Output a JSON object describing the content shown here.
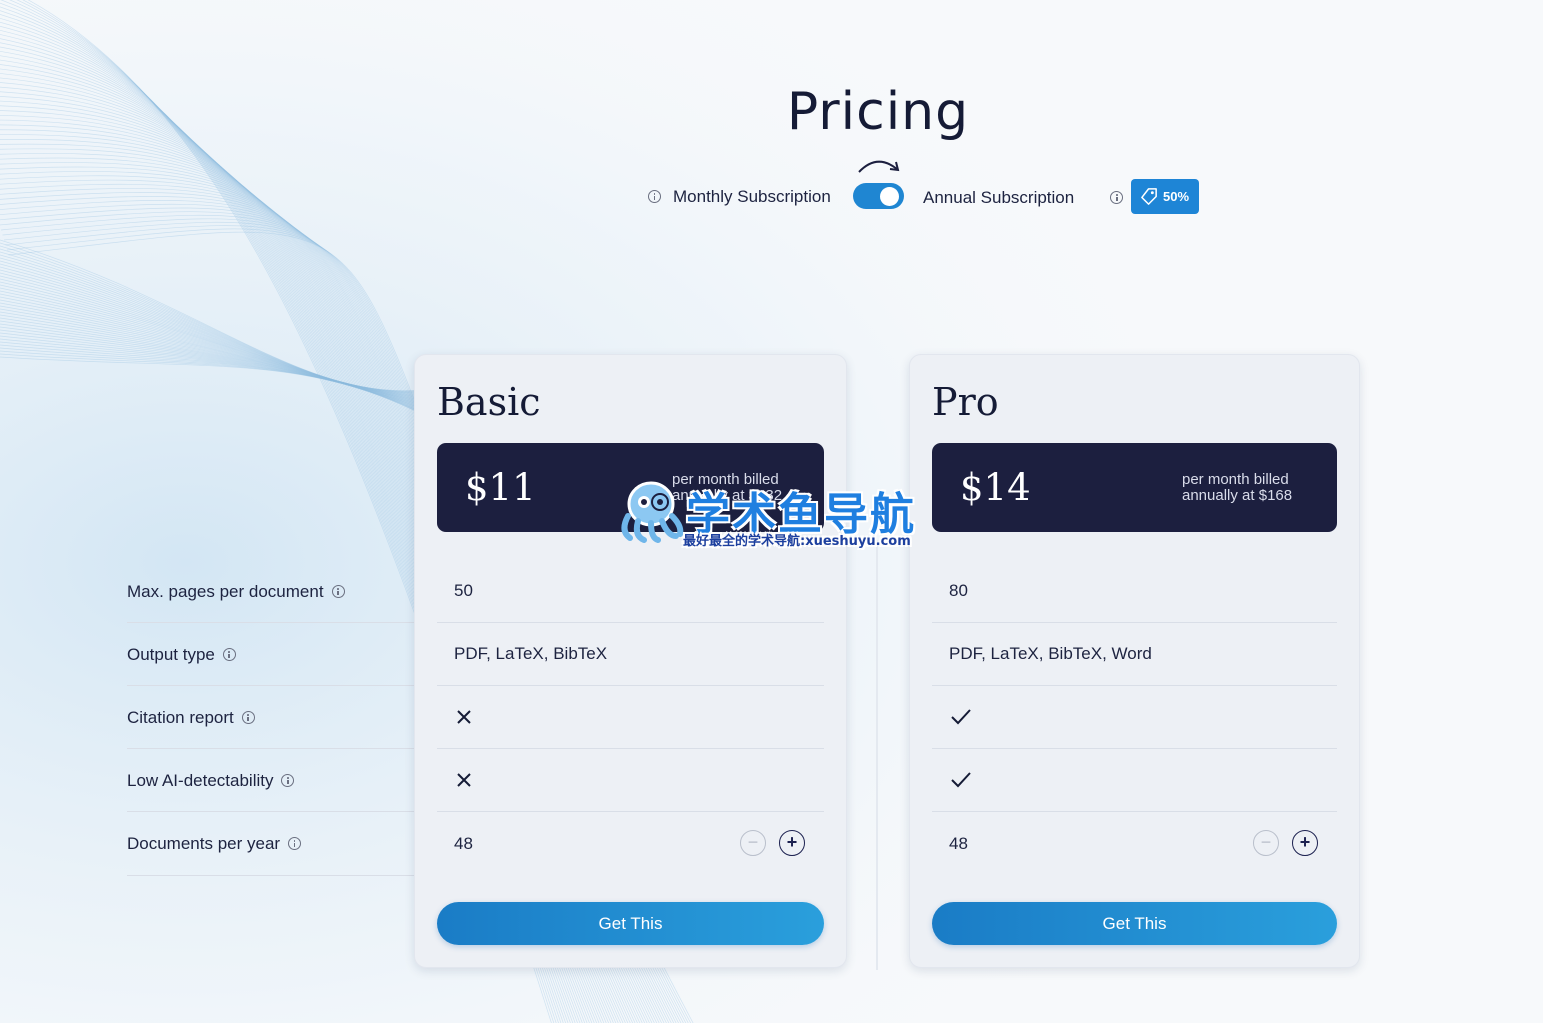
{
  "header": {
    "title": "Pricing"
  },
  "billing_toggle": {
    "monthly_label": "Monthly Subscription",
    "annual_label": "Annual Subscription",
    "selected": "annual",
    "discount_badge": "50%"
  },
  "features": [
    {
      "label": "Max. pages per document"
    },
    {
      "label": "Output type"
    },
    {
      "label": "Citation report"
    },
    {
      "label": "Low AI-detectability"
    },
    {
      "label": "Documents per year"
    }
  ],
  "plans": [
    {
      "name": "Basic",
      "price": "$11",
      "price_note_line1": "per month billed",
      "price_note_line2": "annually at $132",
      "max_pages": "50",
      "output_type": "PDF, LaTeX, BibTeX",
      "citation_report": false,
      "low_ai_detectability": false,
      "documents_per_year": "48",
      "cta": "Get This"
    },
    {
      "name": "Pro",
      "price": "$14",
      "price_note_line1": "per month billed",
      "price_note_line2": "annually at $168",
      "max_pages": "80",
      "output_type": "PDF, LaTeX, BibTeX, Word",
      "citation_report": true,
      "low_ai_detectability": true,
      "documents_per_year": "48",
      "cta": "Get This"
    }
  ],
  "watermark": {
    "title": "学术鱼导航",
    "subtitle": "最好最全的学术导航:xueshuyu.com"
  },
  "colors": {
    "accent": "#1f86d2",
    "dark": "#1c1f3f",
    "card": "#edf0f5"
  }
}
